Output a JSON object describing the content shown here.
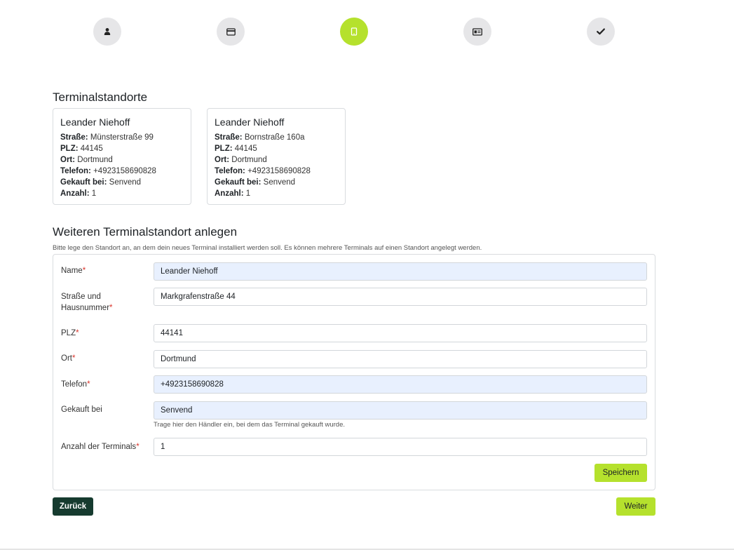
{
  "stepper": {
    "steps": [
      {
        "icon": "user-icon",
        "active": false
      },
      {
        "icon": "credit-card-icon",
        "active": false
      },
      {
        "icon": "tablet-icon",
        "active": true
      },
      {
        "icon": "id-card-icon",
        "active": false
      },
      {
        "icon": "check-icon",
        "active": false
      }
    ],
    "active_color": "#b5e12d",
    "inactive_color": "#e6e6e8"
  },
  "locations": {
    "title": "Terminalstandorte",
    "cards": [
      {
        "name": "Leander Niehoff",
        "street_label": "Straße:",
        "street": "Münsterstraße 99",
        "zip_label": "PLZ:",
        "zip": "44145",
        "city_label": "Ort:",
        "city": "Dortmund",
        "phone_label": "Telefon:",
        "phone": "+4923158690828",
        "bought_label": "Gekauft bei:",
        "bought": "Senvend",
        "count_label": "Anzahl:",
        "count": "1"
      },
      {
        "name": "Leander Niehoff",
        "street_label": "Straße:",
        "street": "Bornstraße 160a",
        "zip_label": "PLZ:",
        "zip": "44145",
        "city_label": "Ort:",
        "city": "Dortmund",
        "phone_label": "Telefon:",
        "phone": "+4923158690828",
        "bought_label": "Gekauft bei:",
        "bought": "Senvend",
        "count_label": "Anzahl:",
        "count": "1"
      }
    ]
  },
  "new_location": {
    "title": "Weiteren Terminalstandort anlegen",
    "hint": "Bitte lege den Standort an, an dem dein neues Terminal installiert werden soll. Es können mehrere Terminals auf einen Standort angelegt werden.",
    "required_mark": "*",
    "fields": {
      "name": {
        "label": "Name",
        "value": "Leander Niehoff"
      },
      "street": {
        "label_line1": "Straße und",
        "label_line2": "Hausnummer",
        "value": "Markgrafenstraße 44"
      },
      "zip": {
        "label": "PLZ",
        "value": "44141"
      },
      "city": {
        "label": "Ort",
        "value": "Dortmund"
      },
      "phone": {
        "label": "Telefon",
        "value": "+4923158690828"
      },
      "bought": {
        "label": "Gekauft bei",
        "value": "Senvend",
        "help": "Trage hier den Händler ein, bei dem das Terminal gekauft wurde."
      },
      "count": {
        "label": "Anzahl der Terminals",
        "value": "1"
      }
    },
    "save_label": "Speichern"
  },
  "nav": {
    "back_label": "Zurück",
    "next_label": "Weiter"
  },
  "colors": {
    "accent": "#b5e12d",
    "dark_button": "#163b2f",
    "required": "#d9342b",
    "autofill": "#e8f0fe"
  }
}
